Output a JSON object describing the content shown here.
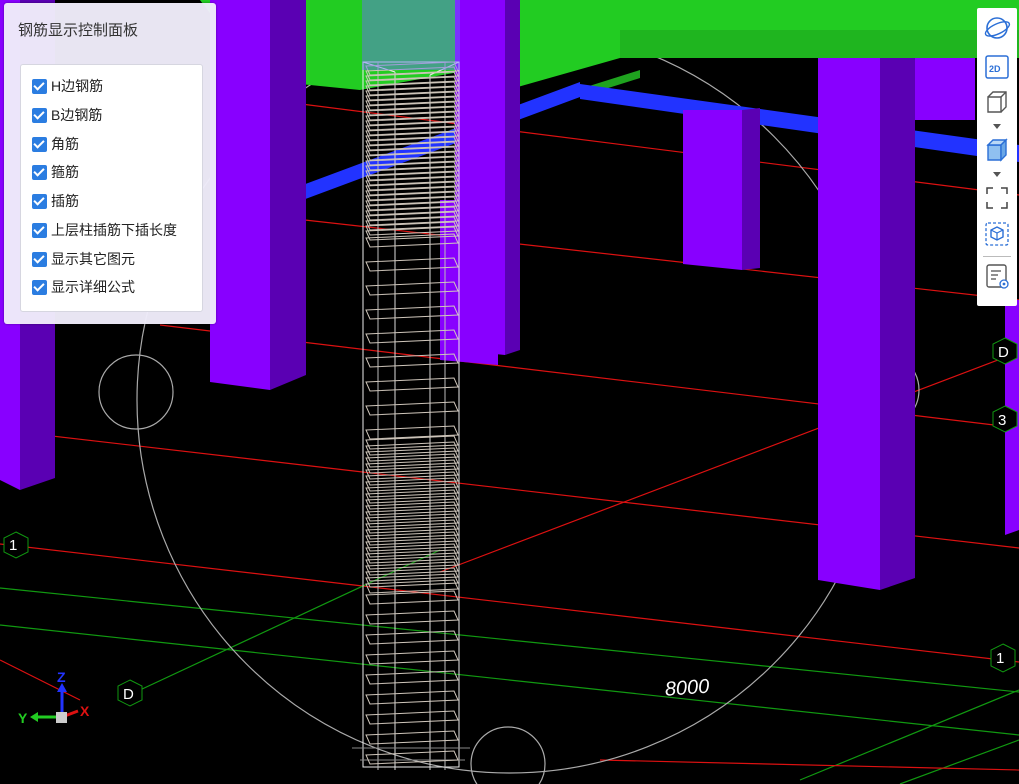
{
  "panel": {
    "title": "钢筋显示控制面板",
    "options": [
      {
        "label": "H边钢筋",
        "checked": true
      },
      {
        "label": "B边钢筋",
        "checked": true
      },
      {
        "label": "角筋",
        "checked": true
      },
      {
        "label": "箍筋",
        "checked": true
      },
      {
        "label": "插筋",
        "checked": true
      },
      {
        "label": "上层柱插筋下插长度",
        "checked": true
      },
      {
        "label": "显示其它图元",
        "checked": true
      },
      {
        "label": "显示详细公式",
        "checked": true
      }
    ]
  },
  "viewport": {
    "dimension_label": "8000",
    "axis_labels": [
      "1",
      "D",
      "1",
      "D",
      "3"
    ],
    "gizmo": {
      "z": "Z",
      "y": "Y",
      "x": "X"
    }
  },
  "toolbar": {
    "items": [
      "orbit-icon",
      "2d-view-icon",
      "3d-box-icon",
      "3d-solid-icon",
      "zoom-extents-icon",
      "view-cube-icon",
      "properties-icon"
    ],
    "view_2d_label": "2D"
  },
  "colors": {
    "column": "#8800ff",
    "column_dark": "#5a00b3",
    "slab": "#22cc22",
    "beam": "#2233ff",
    "grid_red": "#dd1111",
    "grid_green": "#119911",
    "rebar": "#cfc6bb",
    "checkbox": "#2b7de1"
  }
}
